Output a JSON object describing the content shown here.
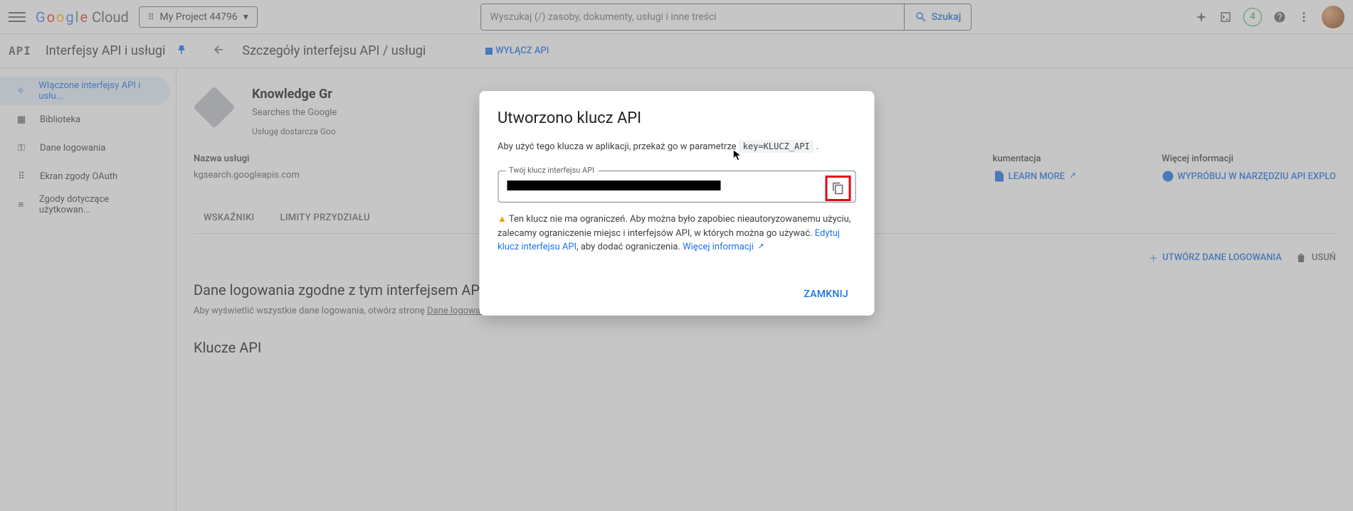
{
  "top": {
    "project": "My Project 44796",
    "search_placeholder": "Wyszukaj (/) zasoby, dokumenty, usługi i inne treści",
    "search_btn": "Szukaj",
    "badge": "4"
  },
  "sub": {
    "api_lbl": "API",
    "title": "Interfejsy API i usługi",
    "detail": "Szczegóły interfejsu API / usługi",
    "disable": "WYŁĄCZ API"
  },
  "side": [
    {
      "label": "Włączone interfejsy API i usłu...",
      "active": true
    },
    {
      "label": "Biblioteka"
    },
    {
      "label": "Dane logowania"
    },
    {
      "label": "Ekran zgody OAuth"
    },
    {
      "label": "Zgody dotyczące użytkowan..."
    }
  ],
  "head": {
    "name": "Knowledge Gr",
    "desc": "Searches the Google",
    "provider": "Usługę dostarcza Goo"
  },
  "cols": {
    "c1h": "Nazwa usługi",
    "c1v": "kgsearch.googleapis.com",
    "c4h": "kumentacja",
    "c4v": "LEARN MORE",
    "c5h": "Więcej informacji",
    "c5v": "WYPRÓBUJ W NARZĘDZIU API EXPLO"
  },
  "tabs": [
    "WSKAŹNIKI",
    "LIMITY PRZYDZIAŁU"
  ],
  "actions": {
    "create": "UTWÓRZ DANE LOGOWANIA",
    "delete": "USUŃ"
  },
  "sec": {
    "h": "Dane logowania zgodne z tym interfejsem API",
    "p1": "Aby wyświetlić wszystkie dane logowania, otwórz stronę ",
    "a1": "Dane logowania w sekcji Interfejsy API i usługi",
    "h2": "Klucze API"
  },
  "modal": {
    "title": "Utworzono klucz API",
    "p1a": "Aby użyć tego klucza w aplikacji, przekaż go w parametrze ",
    "p1code": "key=KLUCZ_API",
    "p1b": " .",
    "flabel": "Twój klucz interfejsu API",
    "warn1": "Ten klucz nie ma ograniczeń. Aby można było zapobiec nieautoryzowanemu użyciu, zalecamy ograniczenie miejsc i interfejsów API, w których można go używać. ",
    "warn_link1": "Edytuj klucz interfejsu API",
    "warn2": ", aby dodać ograniczenia. ",
    "warn_link2": "Więcej informacji",
    "close": "ZAMKNIJ"
  }
}
